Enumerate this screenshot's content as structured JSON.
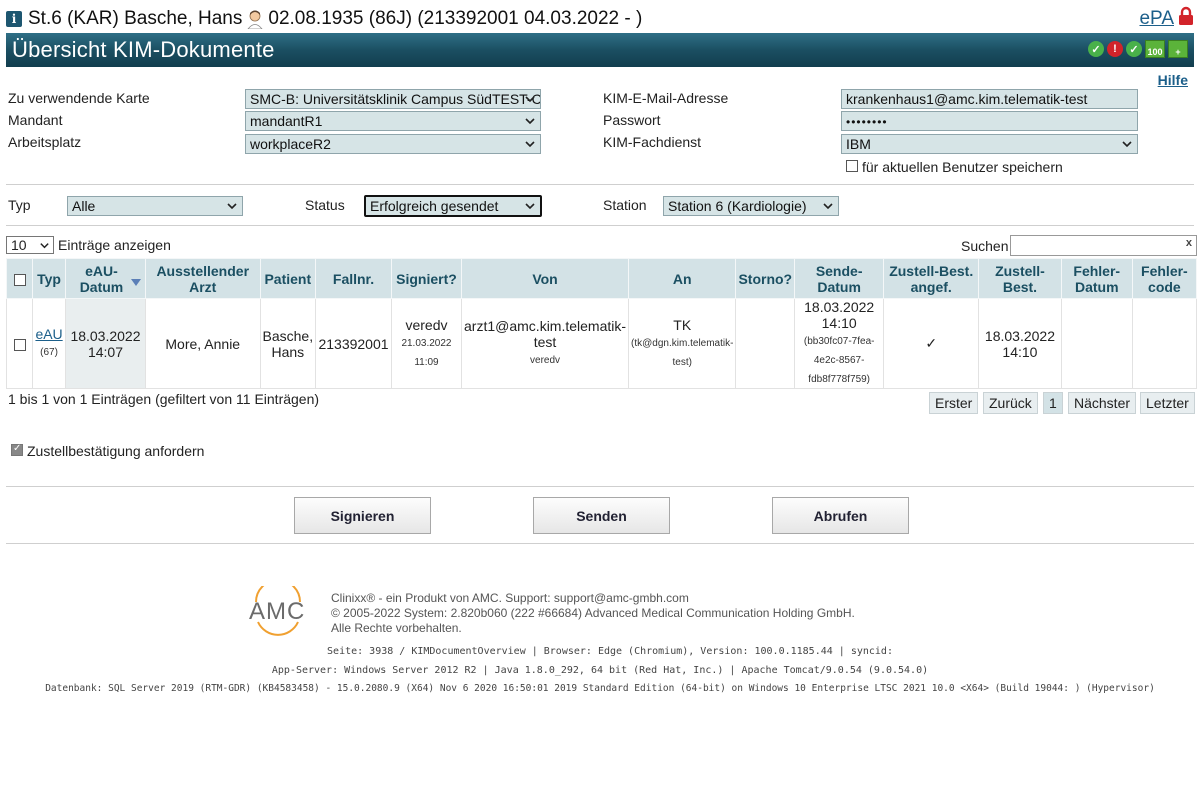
{
  "patient": {
    "text_before_icon": "St.6 (KAR) Basche, Hans",
    "text_after_icon": "02.08.1935 (86J) (213392001 04.03.2022 - )",
    "epa_link": "ePA"
  },
  "title": "Übersicht KIM-Dokumente",
  "title_status_icons": {
    "card_label": "100"
  },
  "help_link": "Hilfe",
  "settings": {
    "karte_label": "Zu verwendende Karte",
    "karte_value": "SMC-B: Universitätsklinik Campus SüdTEST-C",
    "mandant_label": "Mandant",
    "mandant_value": "mandantR1",
    "arbeitsplatz_label": "Arbeitsplatz",
    "arbeitsplatz_value": "workplaceR2",
    "email_label": "KIM-E-Mail-Adresse",
    "email_value": "krankenhaus1@amc.kim.telematik-test",
    "passwort_label": "Passwort",
    "passwort_value": "••••••••",
    "fachdienst_label": "KIM-Fachdienst",
    "fachdienst_value": "IBM",
    "save_user_label": "für aktuellen Benutzer speichern"
  },
  "filters": {
    "typ_label": "Typ",
    "typ_value": "Alle",
    "status_label": "Status",
    "status_value": "Erfolgreich gesendet",
    "station_label": "Station",
    "station_value": "Station 6 (Kardiologie)"
  },
  "table_controls": {
    "length_value": "10",
    "length_label": "Einträge anzeigen",
    "search_label": "Suchen",
    "search_clear": "x"
  },
  "table": {
    "headers": {
      "typ": "Typ",
      "eau_datum": "eAU-Datum",
      "arzt": "Ausstellender Arzt",
      "patient": "Patient",
      "fallnr": "Fallnr.",
      "signiert": "Signiert?",
      "von": "Von",
      "an": "An",
      "storno": "Storno?",
      "sende_datum": "Sende-Datum",
      "zustell_angef": "Zustell-Best. angef.",
      "zustell_best": "Zustell-Best.",
      "fehler_datum": "Fehler-Datum",
      "fehler_code": "Fehler-code"
    },
    "row": {
      "typ_link": "eAU",
      "typ_count": "(67)",
      "eau_datum_date": "18.03.2022",
      "eau_datum_time": "14:07",
      "arzt": "More, Annie",
      "patient_line1": "Basche,",
      "patient_line2": "Hans",
      "fallnr": "213392001",
      "signiert_by": "veredv",
      "signiert_date": "21.03.2022",
      "signiert_time": "11:09",
      "von_line1": "arzt1@amc.kim.telematik-",
      "von_line2": "test",
      "von_user": "veredv",
      "an_name": "TK",
      "an_line1": "(tk@dgn.kim.telematik-",
      "an_line2": "test)",
      "storno": "",
      "sende_date": "18.03.2022",
      "sende_time": "14:10",
      "sende_id1": "(bb30fc07-7fea-",
      "sende_id2": "4e2c-8567-",
      "sende_id3": "fdb8f778f759)",
      "zustell_angef": "✓",
      "zustell_date": "18.03.2022",
      "zustell_time": "14:10",
      "fehler_datum": "",
      "fehler_code": ""
    }
  },
  "pagination": {
    "info": "1 bis 1 von 1 Einträgen (gefiltert von 11 Einträgen)",
    "first": "Erster",
    "prev": "Zurück",
    "page": "1",
    "next": "Nächster",
    "last": "Letzter"
  },
  "zustell_request_label": "Zustellbestätigung anfordern",
  "buttons": {
    "signieren": "Signieren",
    "senden": "Senden",
    "abrufen": "Abrufen"
  },
  "footer": {
    "logo_text": "AMC",
    "line1": "Clinixx® - ein Produkt von AMC. Support: support@amc-gmbh.com",
    "line2": "© 2005-2022 System: 2.820b060 (222 #66684) Advanced Medical Communication Holding GmbH.",
    "line3": "Alle Rechte vorbehalten.",
    "info1": "Seite: 3938 / KIMDocumentOverview | Browser: Edge (Chromium), Version: 100.0.1185.44 | syncid:",
    "info2": "App-Server: Windows Server 2012 R2 | Java 1.8.0_292, 64 bit (Red Hat, Inc.) | Apache Tomcat/9.0.54 (9.0.54.0)",
    "info3": "Datenbank: SQL Server 2019 (RTM-GDR) (KB4583458) - 15.0.2080.9 (X64) Nov 6 2020 16:50:01 2019 Standard Edition (64-bit) on Windows 10 Enterprise LTSC 2021 10.0 <X64> (Build 19044: ) (Hypervisor)"
  },
  "colors": {
    "title_band": "#1b4f62",
    "header_cell": "#d3e2e6",
    "link": "#1c5f8a",
    "field_bg": "#d6e4e6"
  }
}
